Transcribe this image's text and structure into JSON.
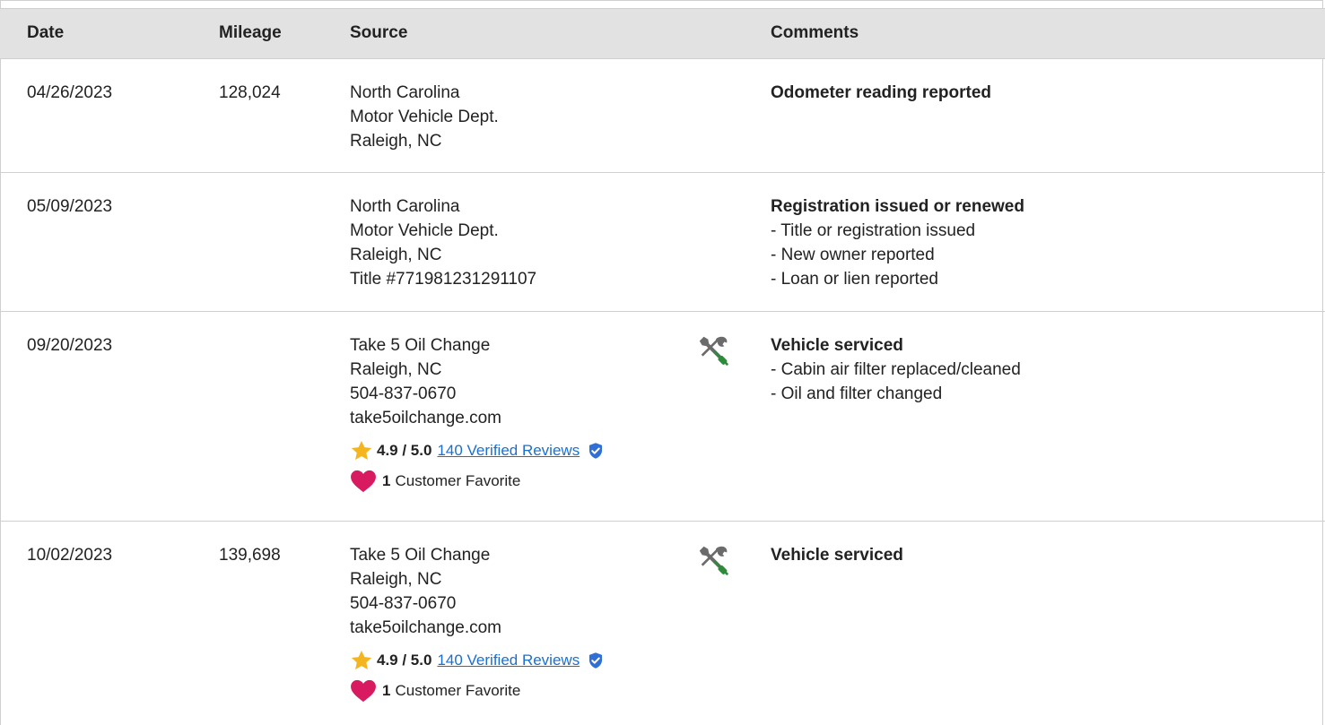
{
  "table": {
    "headers": {
      "date": "Date",
      "mileage": "Mileage",
      "source": "Source",
      "comments": "Comments"
    },
    "rows": [
      {
        "date": "04/26/2023",
        "mileage": "128,024",
        "source": [
          "North Carolina",
          "Motor Vehicle Dept.",
          "Raleigh, NC"
        ],
        "comment_title": "Odometer reading reported",
        "comment_items": []
      },
      {
        "date": "05/09/2023",
        "mileage": "",
        "source": [
          "North Carolina",
          "Motor Vehicle Dept.",
          "Raleigh, NC",
          "Title #771981231291107"
        ],
        "comment_title": "Registration issued or renewed",
        "comment_items": [
          "- Title or registration issued",
          "- New owner reported",
          "- Loan or lien reported"
        ]
      },
      {
        "date": "09/20/2023",
        "mileage": "",
        "source": [
          "Take 5 Oil Change",
          "Raleigh, NC",
          "504-837-0670",
          "take5oilchange.com"
        ],
        "rating": {
          "score": "4.9 / 5.0",
          "reviews_link": "140 Verified Reviews"
        },
        "favorite": {
          "count": "1",
          "label": "Customer Favorite"
        },
        "icon": "service-tools-icon",
        "comment_title": "Vehicle serviced",
        "comment_items": [
          "- Cabin air filter replaced/cleaned",
          "- Oil and filter changed"
        ]
      },
      {
        "date": "10/02/2023",
        "mileage": "139,698",
        "source": [
          "Take 5 Oil Change",
          "Raleigh, NC",
          "504-837-0670",
          "take5oilchange.com"
        ],
        "rating": {
          "score": "4.9 / 5.0",
          "reviews_link": "140 Verified Reviews"
        },
        "favorite": {
          "count": "1",
          "label": "Customer Favorite"
        },
        "icon": "service-tools-icon",
        "comment_title": "Vehicle serviced",
        "comment_items": []
      }
    ]
  },
  "colors": {
    "header_bg": "#e2e2e2",
    "link": "#1a6fd1",
    "star": "#f5b51f",
    "heart": "#d81b60",
    "wrench": "#6b6b6b",
    "screwdriver": "#2e8b3a",
    "badge": "#2f6fd6"
  }
}
